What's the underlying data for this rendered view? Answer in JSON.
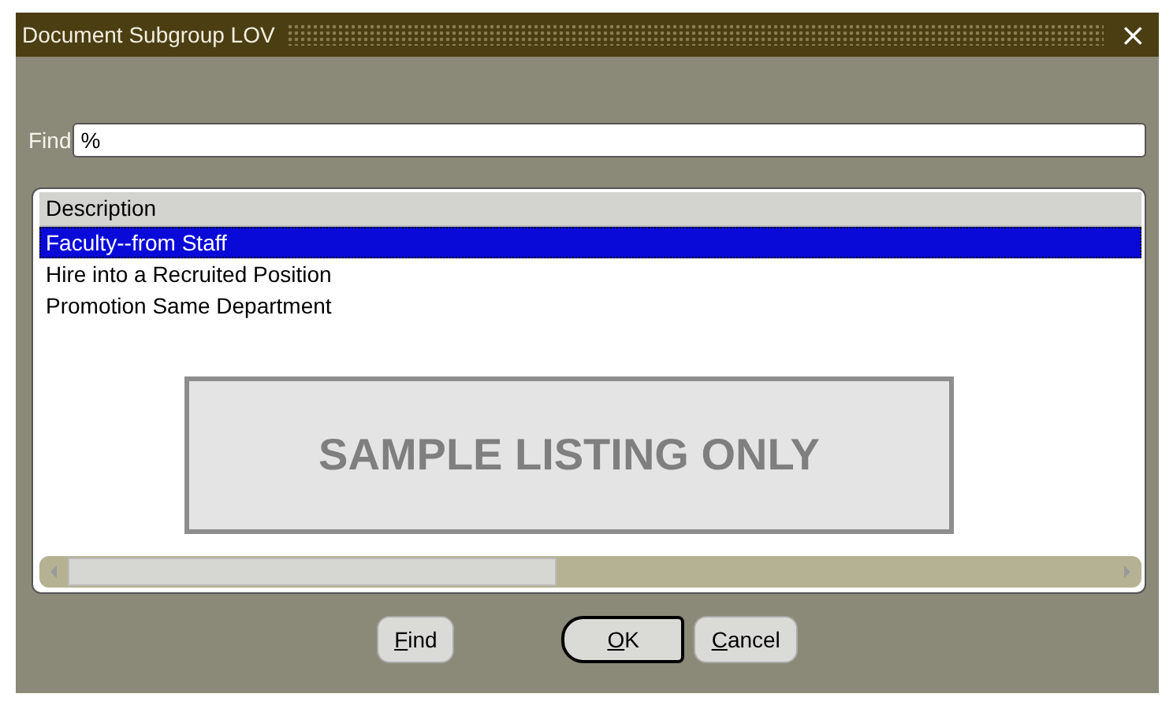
{
  "window": {
    "title": "Document Subgroup LOV",
    "close": "×"
  },
  "find": {
    "label": "Find",
    "value": "%"
  },
  "list": {
    "columns": [
      "Description"
    ],
    "rows": [
      {
        "text": "Faculty--from Staff",
        "selected": true
      },
      {
        "text": "Hire into a Recruited Position",
        "selected": false
      },
      {
        "text": "Promotion Same Department",
        "selected": false
      }
    ],
    "overlay": {
      "text": "SAMPLE LISTING ONLY"
    }
  },
  "buttons": [
    {
      "label": "Find",
      "default": false
    },
    {
      "label": "OK",
      "default": true
    },
    {
      "label": "Cancel",
      "default": false
    }
  ]
}
